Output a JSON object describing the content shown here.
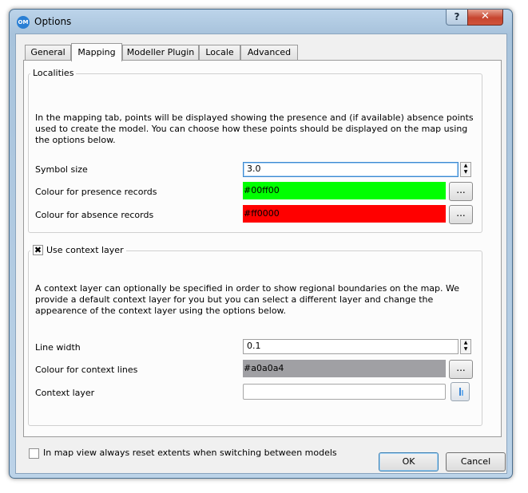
{
  "window": {
    "title": "Options",
    "icon_text": "OM",
    "help_glyph": "?",
    "close_glyph": "✕"
  },
  "tabs": [
    {
      "label": "General"
    },
    {
      "label": "Mapping"
    },
    {
      "label": "Modeller Plugin"
    },
    {
      "label": "Locale"
    },
    {
      "label": "Advanced"
    }
  ],
  "localities": {
    "title": "Localities",
    "description": "In the mapping tab, points will be displayed showing the presence and (if available) absence points used to create the model. You can choose how these points should be displayed on the map using the options below.",
    "symbol_size_label": "Symbol size",
    "symbol_size_value": "3.0",
    "presence_label": "Colour for presence records",
    "presence_value": "#00ff00",
    "absence_label": "Colour for absence records",
    "absence_value": "#ff0000",
    "browse_label": "..."
  },
  "context_layer": {
    "checkbox_label": "Use context layer",
    "checked_glyph": "✖",
    "description": "A context layer can optionally be specified in order to show regional boundaries on the map. We provide a default context layer for you but you can select a different layer and change the appearence of the context layer using the options below.",
    "line_width_label": "Line width",
    "line_width_value": "0.1",
    "line_colour_label": "Colour for context lines",
    "line_colour_value": "#a0a0a4",
    "layer_label": "Context layer",
    "layer_value": "",
    "browse_label": "..."
  },
  "reset_extents_label": "In map view always reset extents when switching between models",
  "buttons": {
    "ok": "OK",
    "cancel": "Cancel"
  },
  "colors": {
    "presence": "#00ff00",
    "absence": "#ff0000",
    "context_lines": "#a0a0a4"
  }
}
